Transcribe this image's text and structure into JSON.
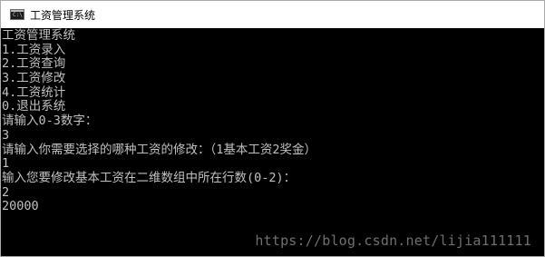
{
  "window": {
    "title": "工资管理系统",
    "icon": "console-window-icon",
    "icon_glyph": "C:\\"
  },
  "console": {
    "lines": [
      "工资管理系统",
      "1.工资录入",
      "2.工资查询",
      "3.工资修改",
      "4.工资统计",
      "0.退出系统",
      "请输入0-3数字：",
      "3",
      "请输入你需要选择的哪种工资的修改：（1基本工资2奖金）",
      "1",
      "输入您要修改基本工资在二维数组中所在行数(0-2)：",
      "2",
      "20000"
    ],
    "background_color": "#000000",
    "text_color": "#c0c0c0"
  },
  "watermark": {
    "text": "https://blog.csdn.net/lijia111111"
  }
}
